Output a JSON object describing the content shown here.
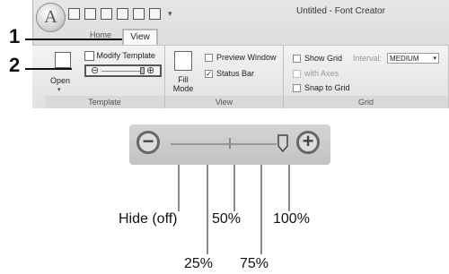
{
  "window": {
    "title": "Untitled - Font Creator"
  },
  "tabs": {
    "home": "Home",
    "view": "View"
  },
  "template_group": {
    "label": "Template",
    "open_label": "Open",
    "modify_label": "Modify Template"
  },
  "view_group": {
    "label": "View",
    "fill_mode_label": "Fill Mode",
    "preview_window_label": "Preview Window",
    "status_bar_label": "Status Bar",
    "preview_window_checked": false,
    "status_bar_checked": true
  },
  "grid_group": {
    "label": "Grid",
    "show_grid_label": "Show Grid",
    "interval_label": "Interval:",
    "interval_value": "MEDIUM",
    "with_axes_label": "with Axes",
    "snap_label": "Snap to Grid"
  },
  "callouts": {
    "one": "1",
    "two": "2"
  },
  "zoom_levels": {
    "hide": "Hide (off)",
    "p25": "25%",
    "p50": "50%",
    "p75": "75%",
    "p100": "100%"
  },
  "icons": [
    "app-orb-icon",
    "new-icon",
    "open-folder-icon",
    "save-icon",
    "print-icon",
    "undo-icon",
    "redo-icon",
    "open-template-icon",
    "modify-template-icon",
    "fill-mode-icon",
    "zoom-minus-icon",
    "zoom-plus-icon",
    "slider-thumb-icon"
  ]
}
